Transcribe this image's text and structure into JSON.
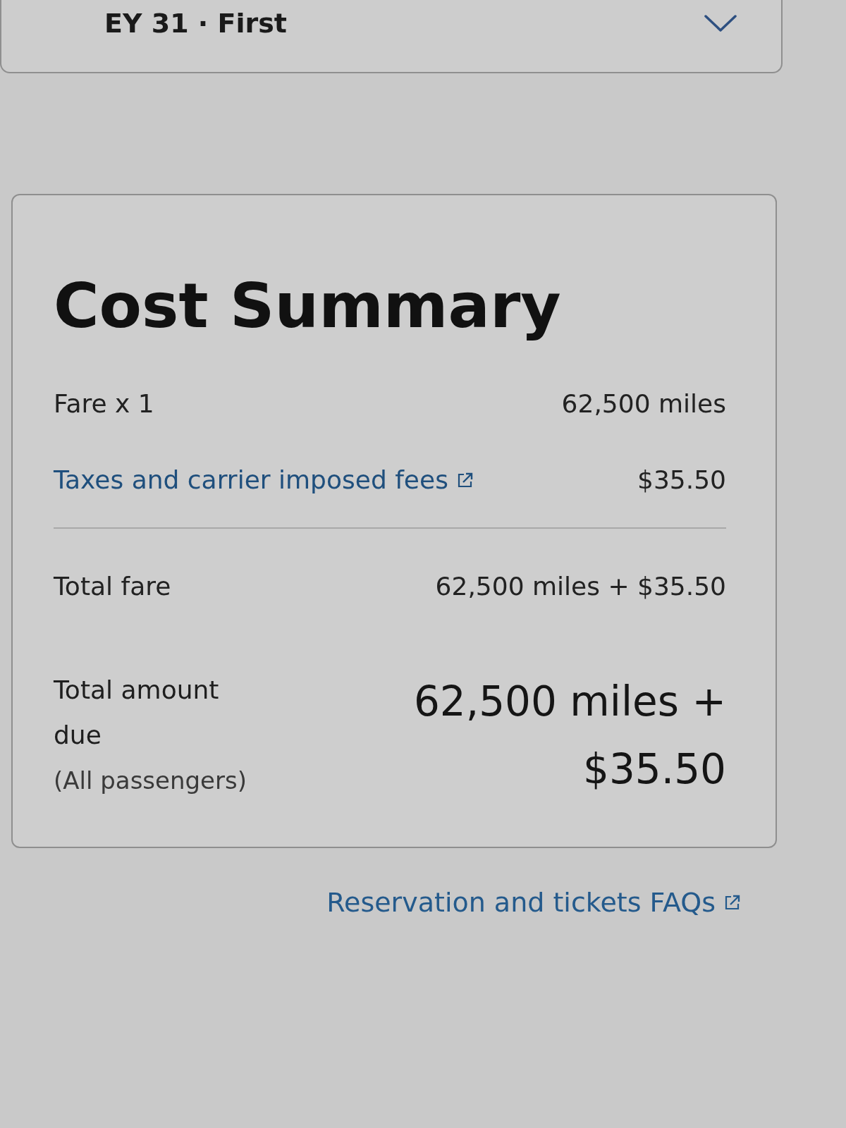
{
  "flight_card": {
    "title": "EY 31 · First",
    "expanded": false
  },
  "cost_summary": {
    "title": "Cost Summary",
    "rows": [
      {
        "kind": "plain",
        "label": "Fare x 1",
        "value": "62,500 miles"
      },
      {
        "kind": "link",
        "label": "Taxes and carrier imposed fees",
        "value": "$35.50"
      },
      {
        "kind": "subtotal",
        "label": "Total fare",
        "value": "62,500 miles + $35.50"
      }
    ],
    "total": {
      "label": "Total amount due",
      "note": "(All passengers)",
      "value": "62,500 miles + $35.50"
    }
  },
  "faq_link": "Reservation and tickets FAQs"
}
